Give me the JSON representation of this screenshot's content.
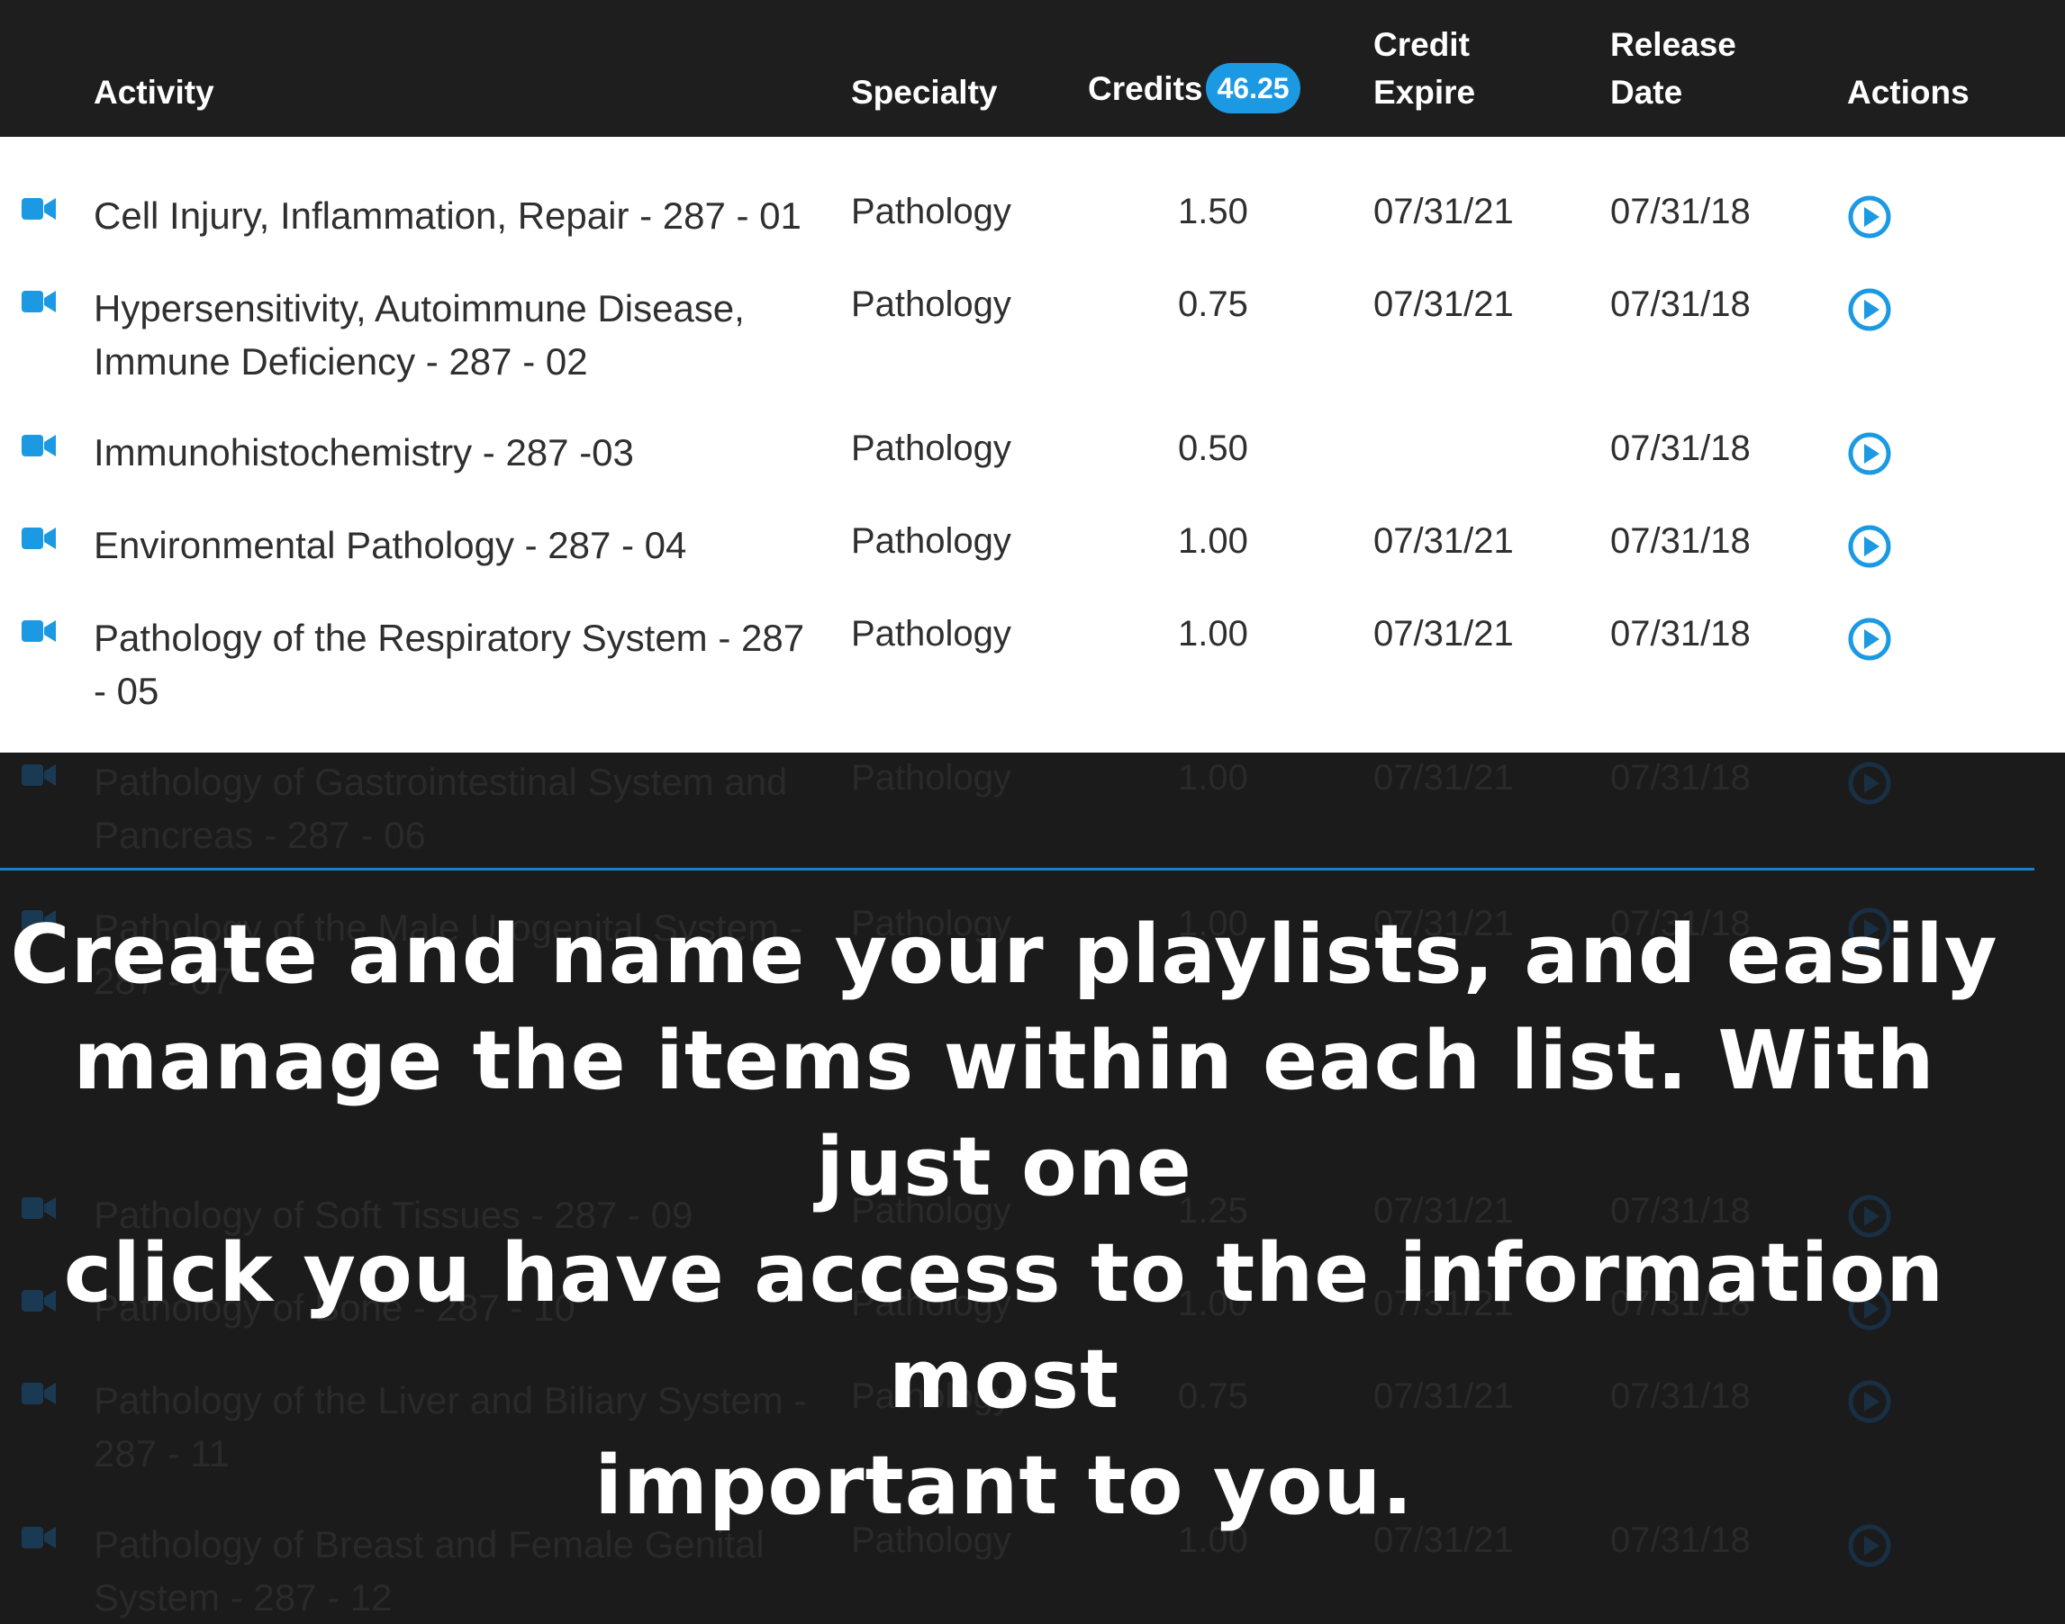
{
  "table": {
    "headers": {
      "activity": "Activity",
      "specialty": "Specialty",
      "credits": "Credits",
      "credits_total": "46.25",
      "credit_expire_line1": "Credit",
      "credit_expire_line2": "Expire",
      "release_date_line1": "Release",
      "release_date_line2": "Date",
      "actions": "Actions"
    },
    "rows": [
      {
        "title_line1": "Cell Injury, Inflammation, Repair - 287 - 01",
        "title_line2": "",
        "specialty": "Pathology",
        "credits": "1.50",
        "expire": "07/31/21",
        "release": "07/31/18"
      },
      {
        "title_line1": "Hypersensitivity, Autoimmune Disease,",
        "title_line2": "Immune Deficiency - 287 - 02",
        "specialty": "Pathology",
        "credits": "0.75",
        "expire": "07/31/21",
        "release": "07/31/18"
      },
      {
        "title_line1": "Immunohistochemistry - 287 -03",
        "title_line2": "",
        "specialty": "Pathology",
        "credits": "0.50",
        "expire": "",
        "release": "07/31/18"
      },
      {
        "title_line1": "Environmental Pathology - 287 - 04",
        "title_line2": "",
        "specialty": "Pathology",
        "credits": "1.00",
        "expire": "07/31/21",
        "release": "07/31/18"
      },
      {
        "title_line1": "Pathology of the Respiratory System - 287",
        "title_line2": "- 05",
        "specialty": "Pathology",
        "credits": "1.00",
        "expire": "07/31/21",
        "release": "07/31/18"
      },
      {
        "title_line1": "Pathology of Gastrointestinal System and",
        "title_line2": "Pancreas - 287 - 06",
        "specialty": "Pathology",
        "credits": "1.00",
        "expire": "07/31/21",
        "release": "07/31/18"
      },
      {
        "title_line1": "Pathology of the Male Urogenital System -",
        "title_line2": "287 - 07",
        "specialty": "Pathology",
        "credits": "1.00",
        "expire": "07/31/21",
        "release": "07/31/18"
      },
      {
        "title_line1": "Pathology of Soft Tissues - 287 - 09",
        "title_line2": "",
        "specialty": "Pathology",
        "credits": "1.25",
        "expire": "07/31/21",
        "release": "07/31/18"
      },
      {
        "title_line1": "Pathology of Bone - 287 - 10",
        "title_line2": "",
        "specialty": "Pathology",
        "credits": "1.00",
        "expire": "07/31/21",
        "release": "07/31/18"
      },
      {
        "title_line1": "Pathology of the Liver and Biliary System -",
        "title_line2": "287 - 11",
        "specialty": "Pathology",
        "credits": "0.75",
        "expire": "07/31/21",
        "release": "07/31/18"
      },
      {
        "title_line1": "Pathology of Breast and Female Genital",
        "title_line2": "System - 287 - 12",
        "specialty": "Pathology",
        "credits": "1.00",
        "expire": "07/31/21",
        "release": "07/31/18"
      }
    ],
    "row_icon": "video-camera-icon",
    "action_icon": "play-circle-icon"
  },
  "caption": {
    "line1": "Create and name your playlists, and easily",
    "line2": "manage the items within each list. With just one",
    "line3": "click you have access to the information most",
    "line4": "important to you."
  },
  "colors": {
    "accent": "#1b9ae3",
    "header_bg": "#1e1e1e",
    "overlay_bg": "#1b1b1b",
    "text": "#2f2f2f"
  }
}
